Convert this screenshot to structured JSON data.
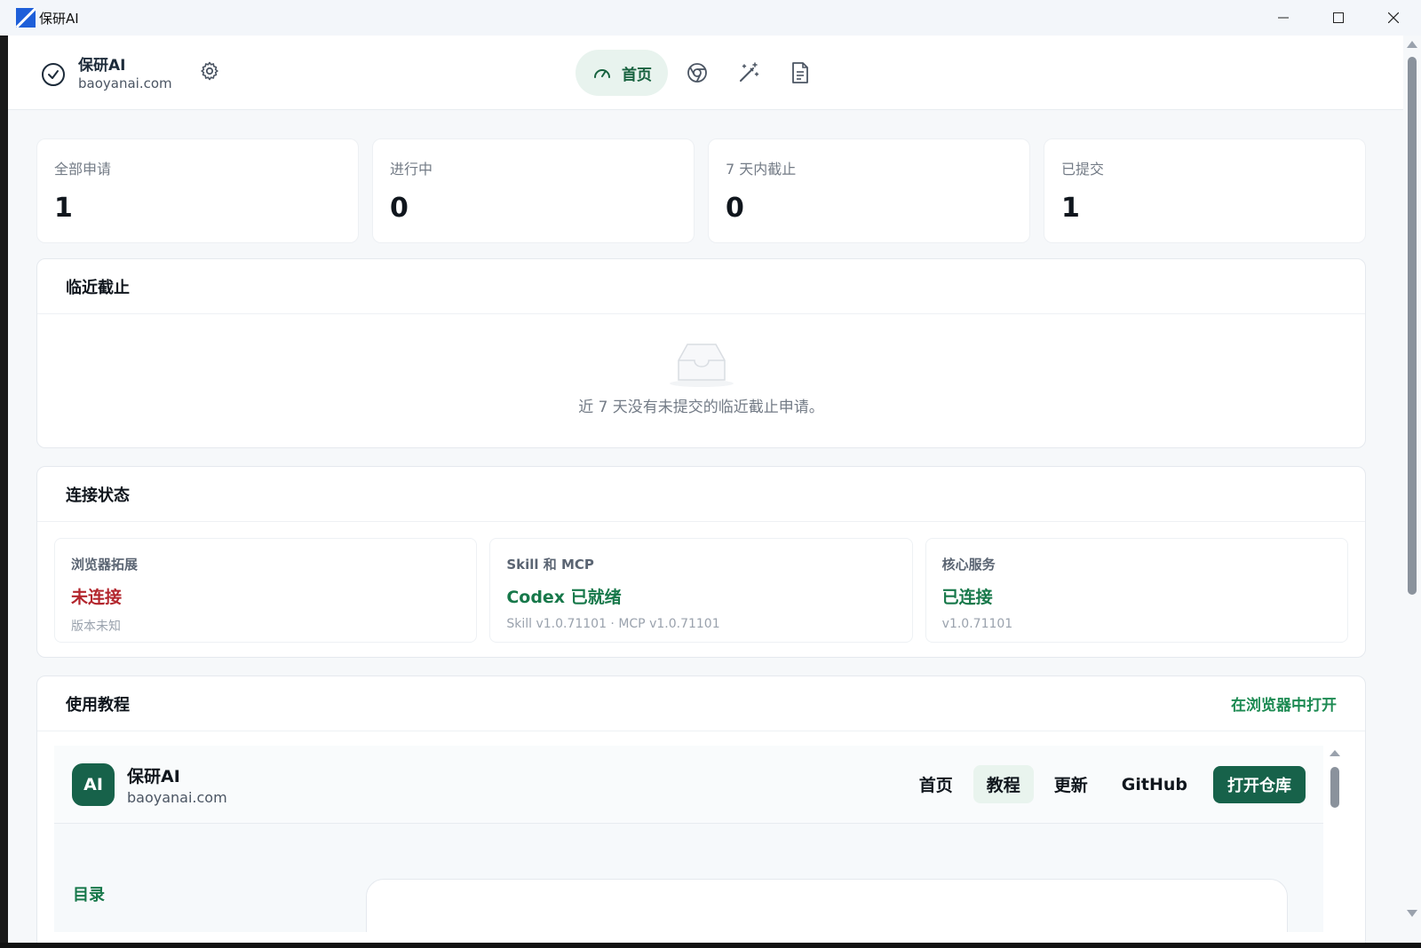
{
  "window": {
    "title": "保研AI"
  },
  "header": {
    "brand_title": "保研AI",
    "brand_sub": "baoyanai.com",
    "nav_home_label": "首页"
  },
  "stats": [
    {
      "label": "全部申请",
      "value": "1"
    },
    {
      "label": "进行中",
      "value": "0"
    },
    {
      "label": "7 天内截止",
      "value": "0"
    },
    {
      "label": "已提交",
      "value": "1"
    }
  ],
  "deadlines": {
    "title": "临近截止",
    "empty_text": "近 7 天没有未提交的临近截止申请。"
  },
  "connection": {
    "title": "连接状态",
    "items": [
      {
        "label": "浏览器拓展",
        "status": "未连接",
        "meta": "版本未知"
      },
      {
        "label": "Skill 和 MCP",
        "status": "Codex 已就绪",
        "meta": "Skill v1.0.71101 · MCP v1.0.71101"
      },
      {
        "label": "核心服务",
        "status": "已连接",
        "meta": "v1.0.71101"
      }
    ]
  },
  "tutorial": {
    "title": "使用教程",
    "open_link": "在浏览器中打开",
    "embed": {
      "logo": "AI",
      "brand_title": "保研AI",
      "brand_sub": "baoyanai.com",
      "nav": [
        "首页",
        "教程",
        "更新",
        "GitHub"
      ],
      "cta": "打开仓库",
      "toc_label": "目录"
    }
  },
  "colors": {
    "accent_green": "#17624a",
    "status_red": "#b3262d",
    "status_green": "#17784a"
  }
}
